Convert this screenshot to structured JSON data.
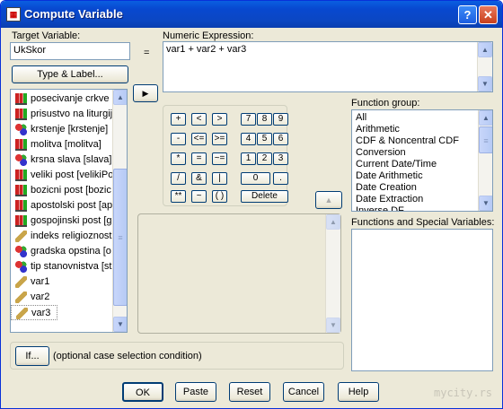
{
  "window": {
    "title": "Compute Variable",
    "help_label": "?",
    "close_label": "✕",
    "app_icon": "spss-grid-icon"
  },
  "target": {
    "label": "Target Variable:",
    "value": "UkSkor",
    "equals": "="
  },
  "type_label_button": "Type & Label...",
  "variables": [
    {
      "name": "posecivanje crkve",
      "icon": "bar"
    },
    {
      "name": "prisustvo na liturgiji",
      "icon": "bar"
    },
    {
      "name": "krstenje [krstenje]",
      "icon": "nominal"
    },
    {
      "name": "molitva [molitva]",
      "icon": "bar"
    },
    {
      "name": "krsna slava [slava]",
      "icon": "nominal"
    },
    {
      "name": "veliki post [velikiPo",
      "icon": "bar"
    },
    {
      "name": "bozicni post [bozic",
      "icon": "bar"
    },
    {
      "name": "apostolski post [ap",
      "icon": "bar"
    },
    {
      "name": "gospojinski post [g",
      "icon": "bar"
    },
    {
      "name": "indeks religioznosti",
      "icon": "ruler"
    },
    {
      "name": "gradska opstina [o",
      "icon": "nominal"
    },
    {
      "name": "tip stanovnistva [st",
      "icon": "nominal"
    },
    {
      "name": "var1",
      "icon": "ruler"
    },
    {
      "name": "var2",
      "icon": "ruler"
    },
    {
      "name": "var3",
      "icon": "ruler"
    }
  ],
  "expression": {
    "label": "Numeric Expression:",
    "value": "var1 + var2 + var3"
  },
  "calculator": {
    "row1": [
      "+",
      "<",
      ">",
      "7",
      "8",
      "9"
    ],
    "row2": [
      "-",
      "<=",
      ">=",
      "4",
      "5",
      "6"
    ],
    "row3": [
      "*",
      "=",
      "~=",
      "1",
      "2",
      "3"
    ],
    "row4": [
      "/",
      "&",
      "|",
      "0",
      "."
    ],
    "row5": [
      "**",
      "~",
      "( )",
      "Delete"
    ]
  },
  "function_group": {
    "label": "Function group:",
    "items": [
      "All",
      "Arithmetic",
      "CDF & Noncentral CDF",
      "Conversion",
      "Current Date/Time",
      "Date Arithmetic",
      "Date Creation",
      "Date Extraction",
      "Inverse DF"
    ]
  },
  "functions_label": "Functions and Special Variables:",
  "if_button": "If...",
  "if_text": "(optional case selection condition)",
  "buttons": {
    "ok": "OK",
    "paste": "Paste",
    "reset": "Reset",
    "cancel": "Cancel",
    "help": "Help"
  },
  "watermark": "mycity.rs"
}
